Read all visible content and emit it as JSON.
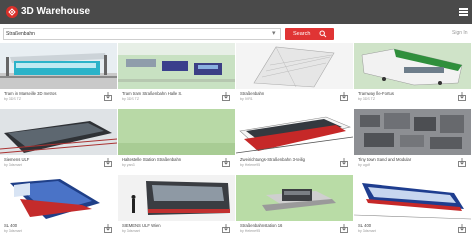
{
  "app": {
    "title": "3D Warehouse"
  },
  "search": {
    "value": "Straßenbahn",
    "button_label": "Search",
    "signin": "Sign In"
  },
  "colors": {
    "topbar": "#4a4a4a",
    "accent": "#e03434",
    "logo": "#d9302a"
  },
  "models": [
    {
      "title": "Tram in Marseille 3D metros",
      "author": "by 3DS TZ",
      "thumb": "tram-station"
    },
    {
      "title": "Tram tram Straßenbahn Halle S.",
      "author": "by 3DS TZ",
      "thumb": "tram-green-scene"
    },
    {
      "title": "Straßenbahn",
      "author": "by IVR1",
      "thumb": "wireframe-tram"
    },
    {
      "title": "Tramway Île-Fortus",
      "author": "by 3DS TZ",
      "thumb": "tram-white-green"
    },
    {
      "title": "Siemens ULF",
      "author": "by 3dsmart",
      "thumb": "tram-dark-rails"
    },
    {
      "title": "Haltestelle Station Straßenbahn",
      "author": "by yan3",
      "thumb": "blank-green"
    },
    {
      "title": "Zweirichtungs-Straßenbahn 3-teilig",
      "author": "by Helene95",
      "thumb": "tram-white-red"
    },
    {
      "title": "Tiny town Sand and Modular",
      "author": "by ugdf",
      "thumb": "city-model"
    },
    {
      "title": "SL 400",
      "author": "by 3dsmart",
      "thumb": "tram-blue-red"
    },
    {
      "title": "SIEMENS ULF Wien",
      "author": "by 3dsmart",
      "thumb": "tram-people"
    },
    {
      "title": "Straßenbahnstation 16",
      "author": "by Helene95",
      "thumb": "station-gray"
    },
    {
      "title": "SL 400",
      "author": "by 3dsmart",
      "thumb": "tram-blue-white"
    }
  ]
}
